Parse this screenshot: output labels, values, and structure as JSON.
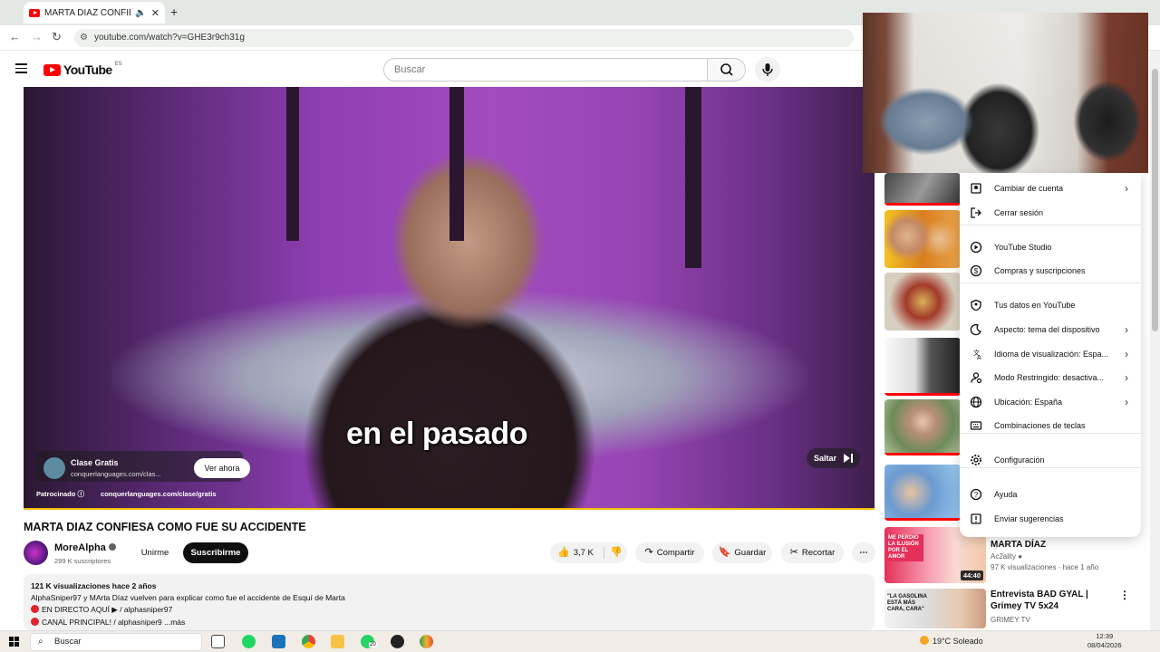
{
  "browser": {
    "tab_title": "MARTA DIAZ CONFIESA CO",
    "url": "youtube.com/watch?v=GHE3r9ch31g",
    "new_tab": "+",
    "back": "←",
    "forward": "→",
    "reload": "↻"
  },
  "masthead": {
    "logo_text": "YouTube",
    "logo_country": "ES",
    "search_placeholder": "Buscar"
  },
  "video": {
    "caption": "en el pasado",
    "ad": {
      "title": "Clase Gratis",
      "url": "conquerlanguages.com/clas...",
      "cta": "Ver ahora",
      "sponsored_label": "Patrocinado",
      "sponsored_url": "conquerlanguages.com/clase/gratis",
      "skip": "Saltar"
    },
    "progress_fraction": 1.0,
    "accent": "#f2c10a"
  },
  "watch": {
    "title": "MARTA DIAZ CONFIESA COMO FUE SU ACCIDENTE",
    "channel_name": "MoreAlpha",
    "channel_subs": "299 K suscriptores",
    "join_label": "Unirme",
    "subscribe_label": "Suscribirme",
    "likes": "3,7 K",
    "share_label": "Compartir",
    "save_label": "Guardar",
    "clip_label": "Recortar",
    "more_label": "⋯",
    "description": {
      "stats": "121 K visualizaciones  hace 2 años",
      "line1": "AlphaSniper97 y MArta Díaz vuelven para explicar como fue el accidente de Esquí de Marta",
      "line2": "EN DIRECTO AQUÍ ▶  / alphasniper97",
      "line3": "CANAL PRINCIPAL!  / alphasniper9 ...más"
    }
  },
  "menu": {
    "items": [
      {
        "label": "Cambiar de cuenta",
        "icon": "switch-account-icon",
        "chevron": true
      },
      {
        "label": "Cerrar sesión",
        "icon": "sign-out-icon",
        "chevron": false
      },
      {
        "label": "YouTube Studio",
        "icon": "studio-icon",
        "chevron": false
      },
      {
        "label": "Compras y suscripciones",
        "icon": "purchases-icon",
        "chevron": false
      },
      {
        "label": "Tus datos en YouTube",
        "icon": "your-data-icon",
        "chevron": false
      },
      {
        "label": "Aspecto: tema del dispositivo",
        "icon": "appearance-icon",
        "chevron": true
      },
      {
        "label": "Idioma de visualización: Espa...",
        "icon": "language-icon",
        "chevron": true
      },
      {
        "label": "Modo Restringido: desactiva...",
        "icon": "restricted-icon",
        "chevron": true
      },
      {
        "label": "Ubicación: España",
        "icon": "location-icon",
        "chevron": true
      },
      {
        "label": "Combinaciones de teclas",
        "icon": "keyboard-icon",
        "chevron": false
      },
      {
        "label": "Configuración",
        "icon": "settings-icon",
        "chevron": false
      },
      {
        "label": "Ayuda",
        "icon": "help-icon",
        "chevron": false
      },
      {
        "label": "Enviar sugerencias",
        "icon": "feedback-icon",
        "chevron": false
      }
    ]
  },
  "recommendations": [
    {
      "title": "MARTA DÍAZ",
      "channel": "Ac2ality",
      "meta": "97 K visualizaciones · hace 1 año",
      "duration": "44:40",
      "thumb_text": "ME PERDIO LA ILUSIÓN POR EL AMOR"
    },
    {
      "title": "Entrevista BAD GYAL | Grimey TV 5x24",
      "channel": "GRIMEY TV",
      "thumb_text": "\"LA GASOLINA ESTÁ MÁS CARA, CARA\""
    }
  ],
  "taskbar": {
    "search": "Buscar",
    "weather": "19°C  Soleado",
    "time": "12:39",
    "date": "08/04/2026",
    "whatsapp_badge": "20"
  }
}
